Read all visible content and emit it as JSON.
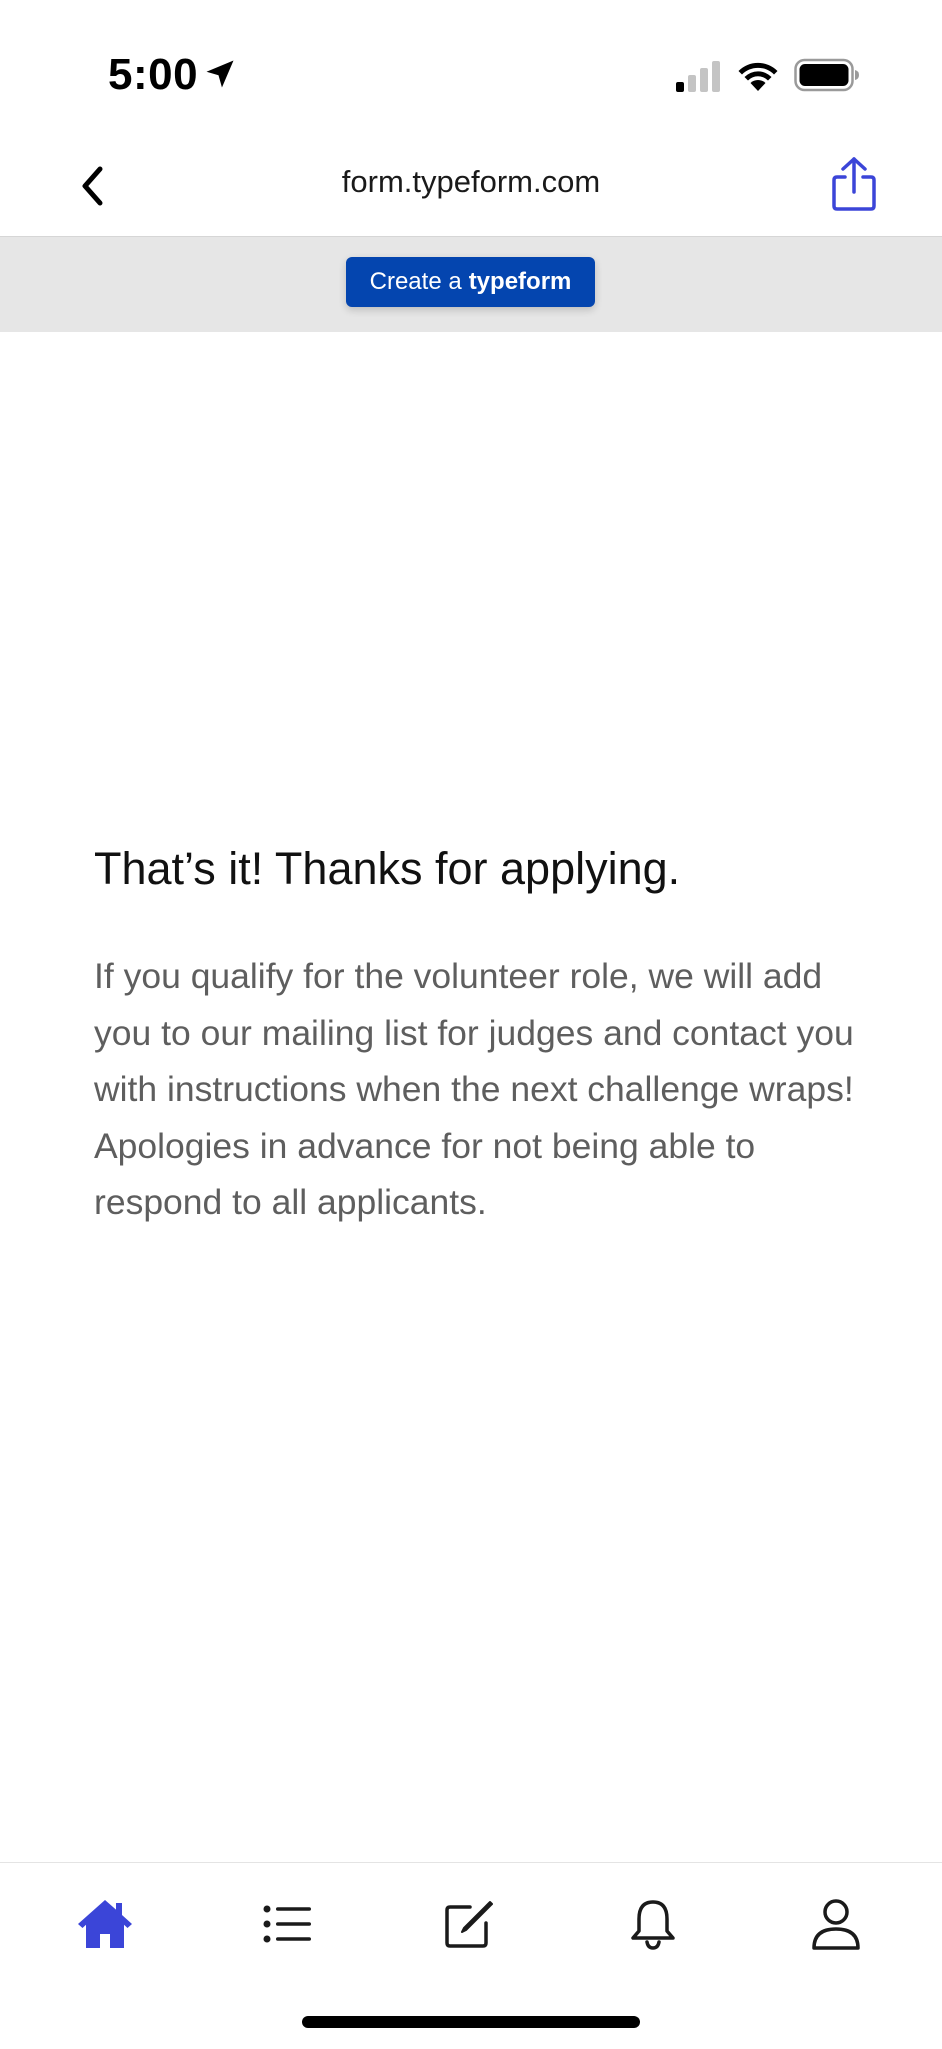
{
  "status_bar": {
    "time": "5:00",
    "icons": [
      "location-arrow-icon",
      "cellular-signal-icon",
      "wifi-icon",
      "battery-icon"
    ]
  },
  "browser": {
    "url": "form.typeform.com",
    "back_icon": "chevron-left-icon",
    "share_icon": "share-icon",
    "accent_color": "#3b45d8"
  },
  "banner": {
    "button_prefix": "Create a",
    "button_brand": "typeform",
    "button_color": "#0445af"
  },
  "content": {
    "heading": "That’s it! Thanks for applying.",
    "message": "If you qualify for the volunteer role, we will add you to our mailing list for judges and contact you with instructions when the next challenge wraps! Apologies in advance for not being able to respond to all applicants."
  },
  "tab_bar": {
    "tabs": [
      {
        "icon": "home-icon",
        "active": true
      },
      {
        "icon": "list-icon",
        "active": false
      },
      {
        "icon": "compose-icon",
        "active": false
      },
      {
        "icon": "bell-icon",
        "active": false
      },
      {
        "icon": "profile-icon",
        "active": false
      }
    ],
    "active_color": "#3b45d8",
    "inactive_color": "#1a1a1a"
  }
}
